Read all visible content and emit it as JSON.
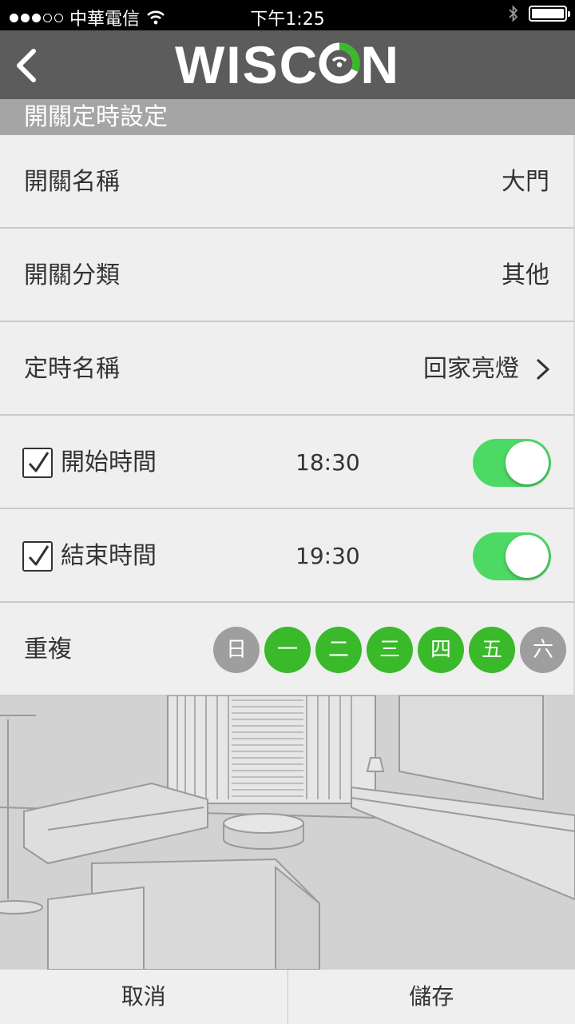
{
  "status_bar": {
    "carrier": "中華電信",
    "time": "下午1:25",
    "signal_dots_filled": 3,
    "signal_dots_total": 5,
    "icons": [
      "wifi-icon",
      "bluetooth-icon",
      "battery-icon"
    ]
  },
  "header": {
    "logo_text_before": "WISC",
    "logo_text_after": "N",
    "back_icon": "chevron-left-icon",
    "accent_color": "#3ab92a"
  },
  "section": {
    "title": "開關定時設定"
  },
  "rows": {
    "switch_name": {
      "label": "開關名稱",
      "value": "大門"
    },
    "switch_category": {
      "label": "開關分類",
      "value": "其他"
    },
    "timer_name": {
      "label": "定時名稱",
      "value": "回家亮燈"
    },
    "start_time": {
      "label": "開始時間",
      "value": "18:30",
      "checked": true,
      "toggle_on": true
    },
    "end_time": {
      "label": "結束時間",
      "value": "19:30",
      "checked": true,
      "toggle_on": true
    },
    "repeat": {
      "label": "重複",
      "days": [
        {
          "label": "日",
          "on": false
        },
        {
          "label": "一",
          "on": true
        },
        {
          "label": "二",
          "on": true
        },
        {
          "label": "三",
          "on": true
        },
        {
          "label": "四",
          "on": true
        },
        {
          "label": "五",
          "on": true
        },
        {
          "label": "六",
          "on": false
        }
      ]
    }
  },
  "footer": {
    "cancel_label": "取消",
    "save_label": "儲存"
  },
  "colors": {
    "toggle_on": "#4cd964",
    "day_on": "#3ab92a",
    "day_off": "#9e9e9e",
    "nav_bg": "#5c5c5c"
  }
}
